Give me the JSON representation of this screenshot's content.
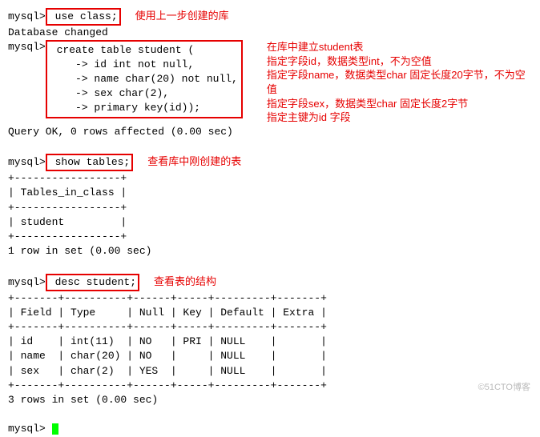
{
  "prompt": "mysql>",
  "cont": "    ->",
  "stmt_use": " use class;",
  "ann_use": "使用上一步创建的库",
  "res_dbchanged": "Database changed",
  "stmt_create_l1": " create table student (",
  "stmt_create_l2": " id int not null,",
  "stmt_create_l3": " name char(20) not null,",
  "stmt_create_l4": " sex char(2),",
  "stmt_create_l5": " primary key(id));",
  "ann_create_l1": "在库中建立student表",
  "ann_create_l2": "指定字段id，数据类型int，不为空值",
  "ann_create_l3": "指定字段name，数据类型char 固定长度20字节，不为空值",
  "ann_create_l4": "指定字段sex，数据类型char 固定长度2字节",
  "ann_create_l5": "指定主键为id 字段",
  "res_queryok": "Query OK, 0 rows affected (0.00 sec)",
  "stmt_showtables": " show tables;",
  "ann_showtables": "查看库中刚创建的表",
  "table_sep1": "+-----------------+",
  "table_header": "| Tables_in_class |",
  "table_row": "| student         |",
  "res_1row": "1 row in set (0.00 sec)",
  "stmt_desc": " desc student;",
  "ann_desc": "查看表的结构",
  "desc_sep": "+-------+----------+------+-----+---------+-------+",
  "desc_header": "| Field | Type     | Null | Key | Default | Extra |",
  "desc_row1": "| id    | int(11)  | NO   | PRI | NULL    |       |",
  "desc_row2": "| name  | char(20) | NO   |     | NULL    |       |",
  "desc_row3": "| sex   | char(2)  | YES  |     | NULL    |       |",
  "res_3rows": "3 rows in set (0.00 sec)",
  "watermark": "©51CTO博客",
  "chart_data": {
    "type": "table",
    "title": "desc student",
    "columns": [
      "Field",
      "Type",
      "Null",
      "Key",
      "Default",
      "Extra"
    ],
    "rows": [
      {
        "Field": "id",
        "Type": "int(11)",
        "Null": "NO",
        "Key": "PRI",
        "Default": "NULL",
        "Extra": ""
      },
      {
        "Field": "name",
        "Type": "char(20)",
        "Null": "NO",
        "Key": "",
        "Default": "NULL",
        "Extra": ""
      },
      {
        "Field": "sex",
        "Type": "char(2)",
        "Null": "YES",
        "Key": "",
        "Default": "NULL",
        "Extra": ""
      }
    ]
  }
}
